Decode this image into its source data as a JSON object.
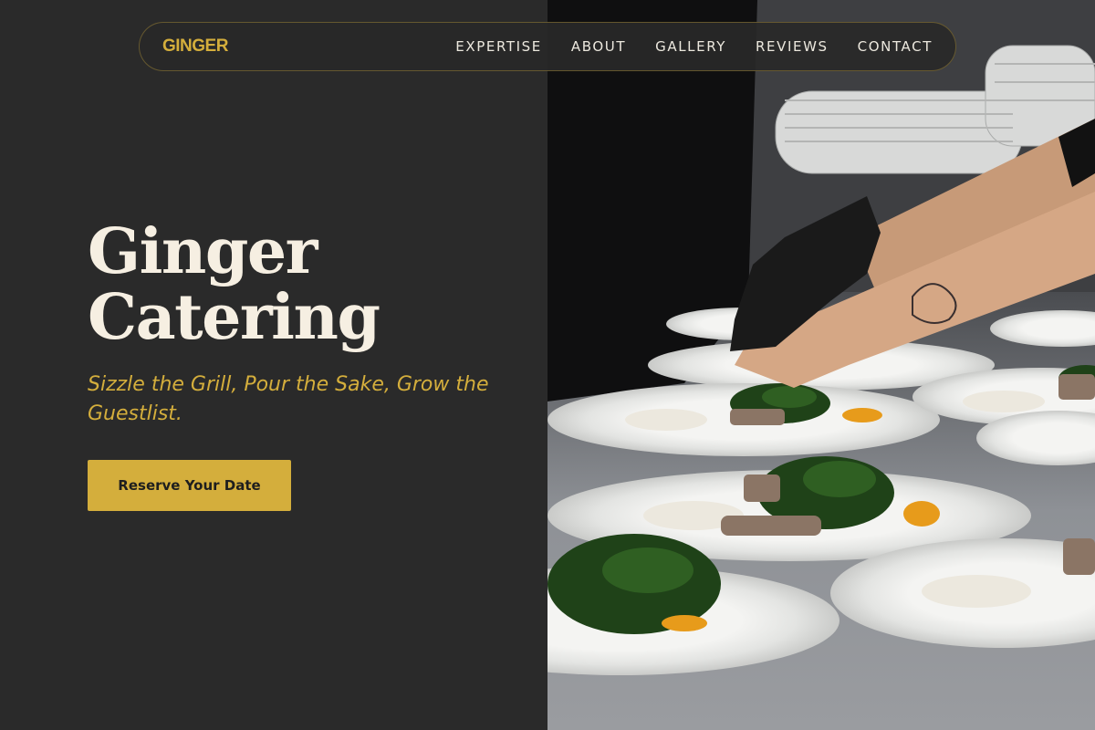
{
  "brand": {
    "logo_text": "GINGER"
  },
  "nav": {
    "items": [
      {
        "label": "EXPERTISE"
      },
      {
        "label": "ABOUT"
      },
      {
        "label": "GALLERY"
      },
      {
        "label": "REVIEWS"
      },
      {
        "label": "CONTACT"
      }
    ]
  },
  "hero": {
    "title_line1": "Ginger",
    "title_line2": "Catering",
    "tagline": "Sizzle the Grill, Pour the Sake, Grow the Guestlist.",
    "cta_label": "Reserve Your Date"
  },
  "colors": {
    "background": "#2a2a2a",
    "accent": "#d4ae3c",
    "title": "#f6efe2",
    "nav_text": "#ece8de"
  }
}
